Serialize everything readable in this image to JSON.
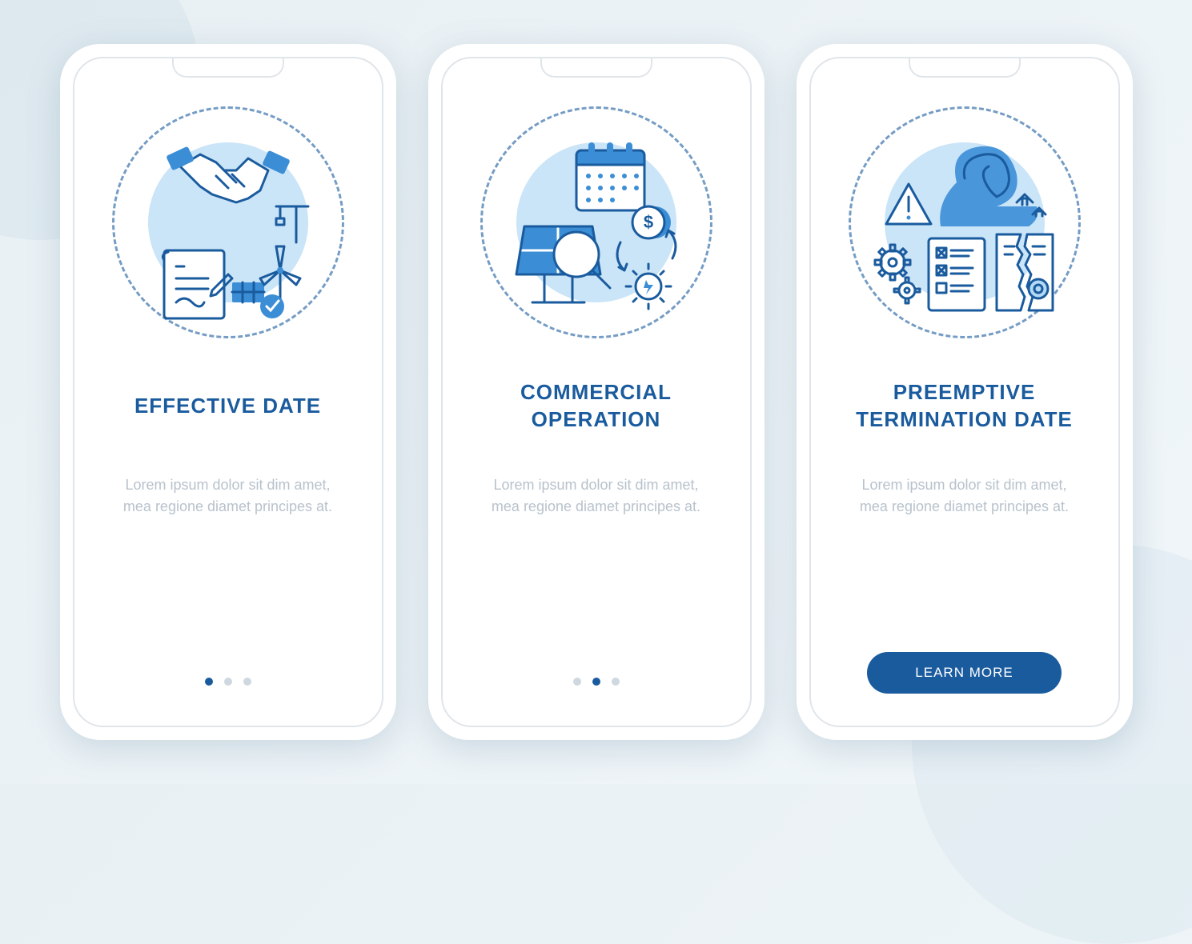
{
  "colors": {
    "primary": "#1a5b9e",
    "accent": "#3b8ed6",
    "light": "#b3d9f5",
    "muted": "#b8c2cc"
  },
  "screens": [
    {
      "title": "EFFECTIVE DATE",
      "description": "Lorem ipsum dolor sit dim amet, mea regione diamet principes at.",
      "icon": "handshake-contract",
      "active_dot": 0,
      "has_button": false
    },
    {
      "title": "COMMERCIAL OPERATION",
      "description": "Lorem ipsum dolor sit dim amet, mea regione diamet principes at.",
      "icon": "calendar-solar",
      "active_dot": 1,
      "has_button": false
    },
    {
      "title": "PREEMPTIVE TERMINATION DATE",
      "description": "Lorem ipsum dolor sit dim amet, mea regione diamet principes at.",
      "icon": "warning-document",
      "active_dot": 2,
      "has_button": true,
      "button_label": "LEARN MORE"
    }
  ]
}
